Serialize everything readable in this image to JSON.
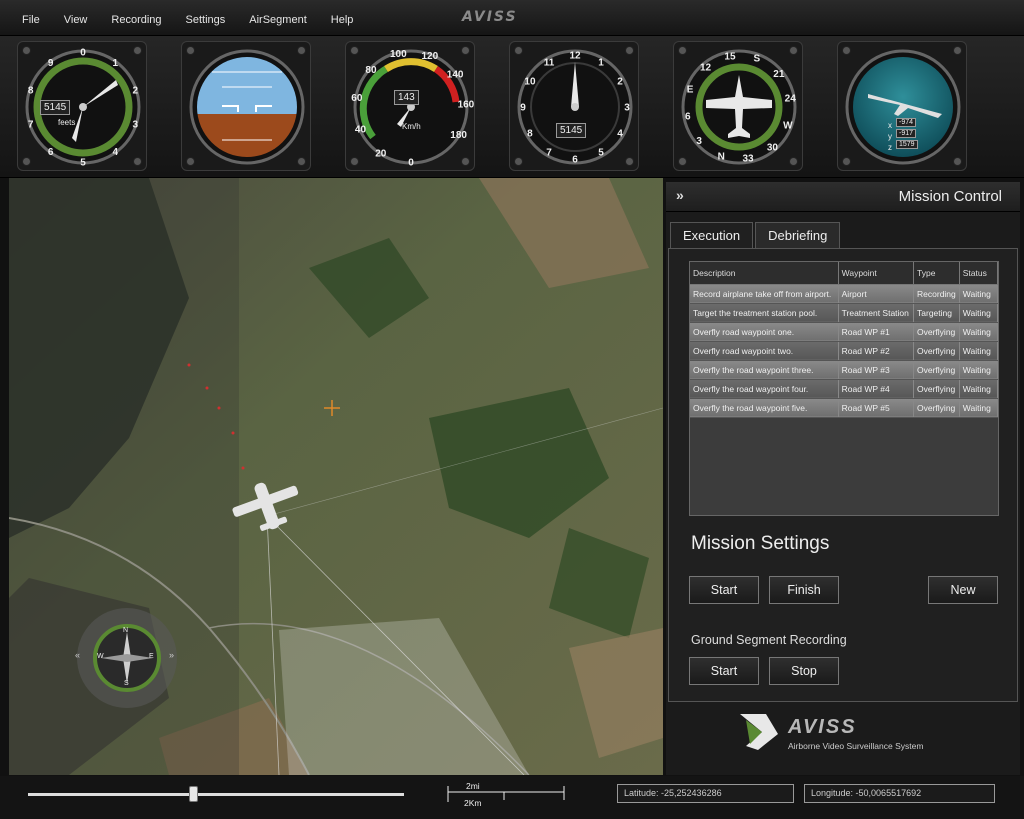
{
  "menu": {
    "items": [
      "File",
      "View",
      "Recording",
      "Settings",
      "AirSegment",
      "Help"
    ],
    "logo": "AVISS"
  },
  "instruments": {
    "altimeter": {
      "readout": "5145",
      "unit": "feets",
      "ticks": [
        "0",
        "1",
        "2",
        "3",
        "4",
        "5",
        "6",
        "7",
        "8",
        "9"
      ]
    },
    "attitude": {},
    "airspeed": {
      "readout": "143",
      "unit": "Km/h",
      "ticks": [
        "0",
        "20",
        "40",
        "60",
        "80",
        "100",
        "120",
        "140",
        "160",
        "180"
      ]
    },
    "clock_altimeter": {
      "readout": "5145",
      "ticks": [
        "12",
        "1",
        "2",
        "3",
        "4",
        "5",
        "6",
        "7",
        "8",
        "9",
        "10",
        "11"
      ]
    },
    "heading": {
      "ticks": [
        "N",
        "3",
        "6",
        "E",
        "12",
        "15",
        "S",
        "21",
        "24",
        "W",
        "30",
        "33"
      ]
    },
    "position": {
      "x_label": "x",
      "x": "-974",
      "y_label": "y",
      "y": "-917",
      "z_label": "z",
      "z": "1579"
    },
    "collapse_icon": "double-chevron-up-icon"
  },
  "map": {
    "compass_labels": [
      "N",
      "E",
      "S",
      "W"
    ],
    "nav_icons": [
      "double-chevron-left-icon",
      "double-chevron-right-icon"
    ]
  },
  "mission_control": {
    "title": "Mission Control",
    "tabs": [
      "Execution",
      "Debriefing"
    ],
    "table": {
      "columns": [
        "Description",
        "Waypoint",
        "Type",
        "Status"
      ],
      "rows": [
        [
          "Record airplane take off from airport.",
          "Airport",
          "Recording",
          "Waiting"
        ],
        [
          "Target the treatment station pool.",
          "Treatment Station",
          "Targeting",
          "Waiting"
        ],
        [
          "Overfly road waypoint one.",
          "Road WP #1",
          "Overflying",
          "Waiting"
        ],
        [
          "Overfly road waypoint two.",
          "Road WP #2",
          "Overflying",
          "Waiting"
        ],
        [
          "Overfly the road waypoint three.",
          "Road WP #3",
          "Overflying",
          "Waiting"
        ],
        [
          "Overfly the road waypoint four.",
          "Road WP #4",
          "Overflying",
          "Waiting"
        ],
        [
          "Overfly the road waypoint five.",
          "Road WP #5",
          "Overflying",
          "Waiting"
        ]
      ]
    },
    "mission_settings": {
      "title": "Mission Settings",
      "start_label": "Start",
      "finish_label": "Finish",
      "new_label": "New"
    },
    "ground_recording": {
      "title": "Ground Segment Recording",
      "start_label": "Start",
      "stop_label": "Stop"
    },
    "brand": {
      "name": "AVISS",
      "subtitle": "Airborne Video Surveillance System"
    }
  },
  "statusbar": {
    "zoom_fraction": 0.44,
    "scale_mi": "2mi",
    "scale_km": "2Km",
    "latitude": "Latitude: -25,252436286",
    "longitude": "Longitude: -50,0065517692"
  },
  "colors": {
    "accent_green": "#5a8a32",
    "sky": "#7fb6e0",
    "ground": "#9c4a1c"
  }
}
